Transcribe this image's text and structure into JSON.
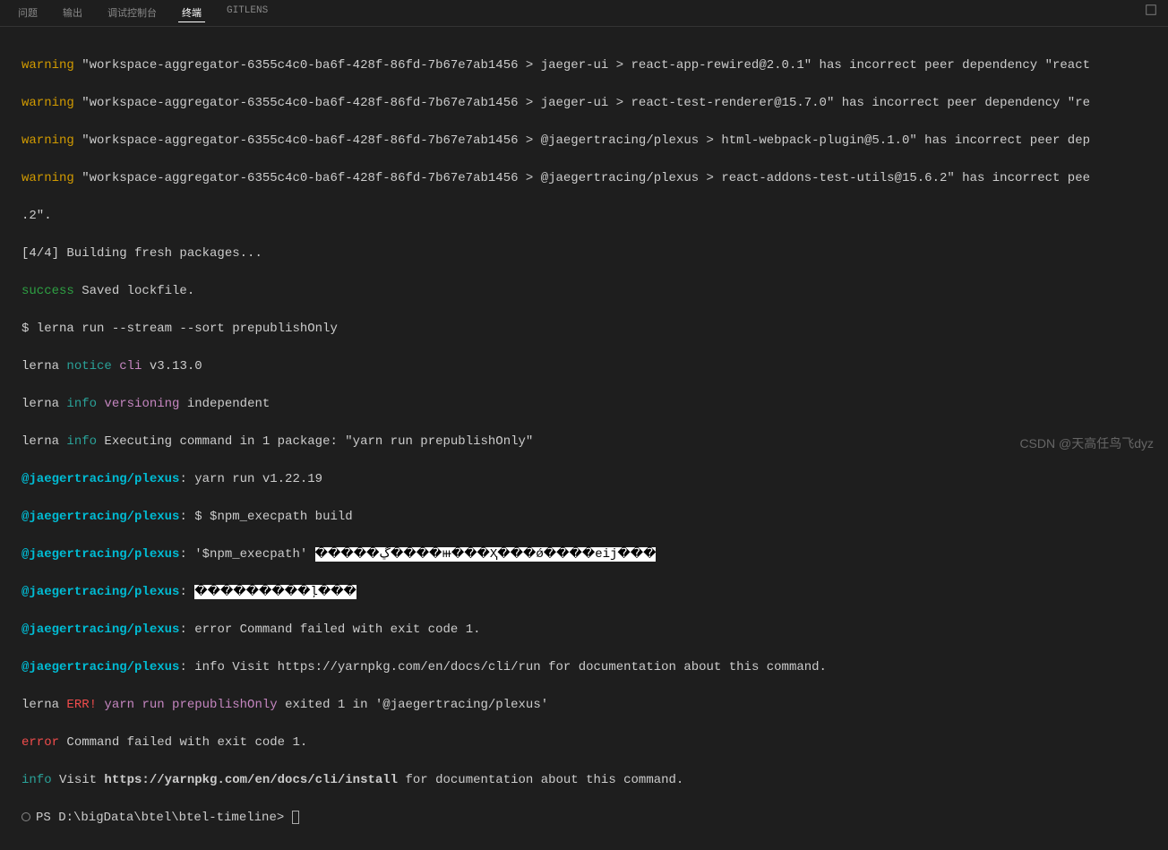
{
  "tabs": {
    "t1": "问题",
    "t2": "输出",
    "t3": "调试控制台",
    "t4": "终端",
    "t5": "GITLENS"
  },
  "lines": {
    "w1_pre": "warning",
    "w1_post": " \"workspace-aggregator-6355c4c0-ba6f-428f-86fd-7b67e7ab1456 > jaeger-ui > react-app-rewired@2.0.1\" has incorrect peer dependency \"react",
    "w2_pre": "warning",
    "w2_post": " \"workspace-aggregator-6355c4c0-ba6f-428f-86fd-7b67e7ab1456 > jaeger-ui > react-test-renderer@15.7.0\" has incorrect peer dependency \"re",
    "w3_pre": "warning",
    "w3_post": " \"workspace-aggregator-6355c4c0-ba6f-428f-86fd-7b67e7ab1456 > @jaegertracing/plexus > html-webpack-plugin@5.1.0\" has incorrect peer dep",
    "w4_pre": "warning",
    "w4_post": " \"workspace-aggregator-6355c4c0-ba6f-428f-86fd-7b67e7ab1456 > @jaegertracing/plexus > react-addons-test-utils@15.6.2\" has incorrect pee",
    "w4_cont": ".2\".",
    "build": "[4/4] Building fresh packages...",
    "success_pre": "success",
    "success_post": " Saved lockfile.",
    "cmd1": "$ lerna run --stream --sort prepublishOnly",
    "notice_a": "lerna ",
    "notice_b": "notice",
    "notice_c": " cli",
    "notice_d": " v3.13.0",
    "info1_a": "lerna ",
    "info1_b": "info",
    "info1_c": " versioning",
    "info1_d": " independent",
    "info2_a": "lerna ",
    "info2_b": "info",
    "info2_c": " Executing command in 1 package: \"yarn run prepublishOnly\"",
    "plexus": "@jaegertracing/plexus",
    "p1": ": yarn run v1.22.19",
    "p2": ": $ $npm_execpath build",
    "p3a": ": '$npm_execpath' ",
    "p3b": "�����ڲ����ⲿ���Ҳ���ǿ����еij���",
    "p4a": ": ",
    "p4b": "���������ļ���",
    "p5": ": error Command failed with exit code 1.",
    "p6": ": info Visit https://yarnpkg.com/en/docs/cli/run for documentation about this command.",
    "err_a": "lerna ",
    "err_b": "ERR!",
    "err_c": " yarn run prepublishOnly",
    "err_d": " exited 1 in '@jaegertracing/plexus'",
    "error_pre": "error",
    "error_post": " Command failed with exit code 1.",
    "infov_a": "info",
    "infov_b": " Visit ",
    "infov_c": "https://yarnpkg.com/en/docs/cli/install",
    "infov_d": " for documentation about this command.",
    "prompt": "PS D:\\bigData\\btel\\btel-timeline> "
  },
  "watermark": "CSDN @天高任鸟飞dyz"
}
